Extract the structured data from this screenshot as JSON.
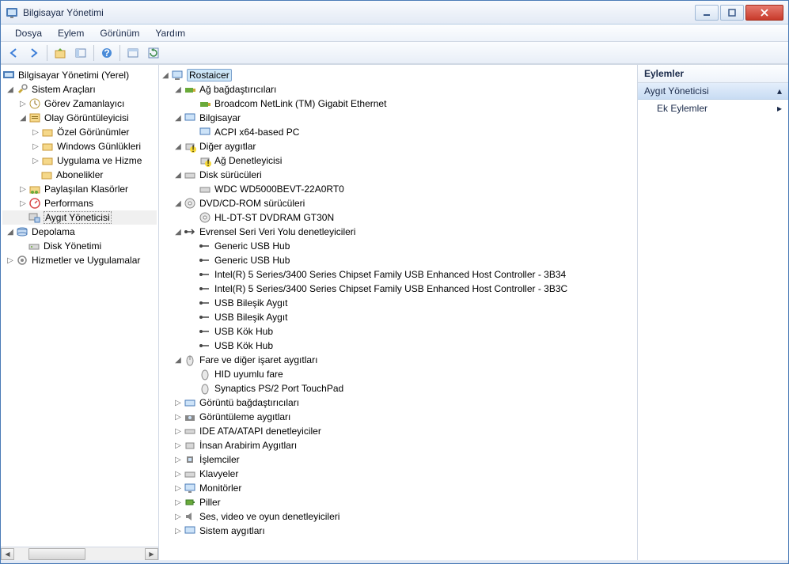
{
  "window": {
    "title": "Bilgisayar Yönetimi"
  },
  "menu": {
    "file": "Dosya",
    "action": "Eylem",
    "view": "Görünüm",
    "help": "Yardım"
  },
  "left_tree": {
    "root": "Bilgisayar Yönetimi (Yerel)",
    "sys_tools": "Sistem Araçları",
    "task_sched": "Görev Zamanlayıcı",
    "event_viewer": "Olay Görüntüleyicisi",
    "custom_views": "Özel Görünümler",
    "windows_logs": "Windows Günlükleri",
    "app_services": "Uygulama ve Hizme",
    "subscriptions": "Abonelikler",
    "shared_folders": "Paylaşılan Klasörler",
    "performance": "Performans",
    "device_manager": "Aygıt Yöneticisi",
    "storage": "Depolama",
    "disk_mgmt": "Disk Yönetimi",
    "services_apps": "Hizmetler ve Uygulamalar"
  },
  "device_tree": {
    "computer": "Rostaicer",
    "net_adapters": "Ağ bağdaştırıcıları",
    "net1": "Broadcom NetLink (TM) Gigabit Ethernet",
    "computer_cat": "Bilgisayar",
    "comp1": "ACPI x64-based PC",
    "other_devices": "Diğer aygıtlar",
    "other1": "Ağ Denetleyicisi",
    "disk_drives": "Disk sürücüleri",
    "disk1": "WDC WD5000BEVT-22A0RT0",
    "dvd_cat": "DVD/CD-ROM sürücüleri",
    "dvd1": "HL-DT-ST DVDRAM GT30N",
    "usb_cat": "Evrensel Seri Veri Yolu denetleyicileri",
    "usb1": "Generic USB Hub",
    "usb2": "Generic USB Hub",
    "usb3": "Intel(R) 5 Series/3400 Series Chipset Family USB Enhanced Host Controller - 3B34",
    "usb4": "Intel(R) 5 Series/3400 Series Chipset Family USB Enhanced Host Controller - 3B3C",
    "usb5": "USB Bileşik Aygıt",
    "usb6": "USB Bileşik Aygıt",
    "usb7": "USB Kök Hub",
    "usb8": "USB Kök Hub",
    "mice_cat": "Fare ve diğer işaret aygıtları",
    "mice1": "HID uyumlu fare",
    "mice2": "Synaptics PS/2 Port TouchPad",
    "display_adapters": "Görüntü bağdaştırıcıları",
    "imaging": "Görüntüleme aygıtları",
    "ide": "IDE ATA/ATAPI denetleyiciler",
    "hid": "İnsan Arabirim Aygıtları",
    "processors": "İşlemciler",
    "keyboards": "Klavyeler",
    "monitors": "Monitörler",
    "batteries": "Piller",
    "sound": "Ses, video ve oyun denetleyicileri",
    "system_devices": "Sistem aygıtları"
  },
  "actions": {
    "header": "Eylemler",
    "section": "Aygıt Yöneticisi",
    "more": "Ek Eylemler"
  }
}
